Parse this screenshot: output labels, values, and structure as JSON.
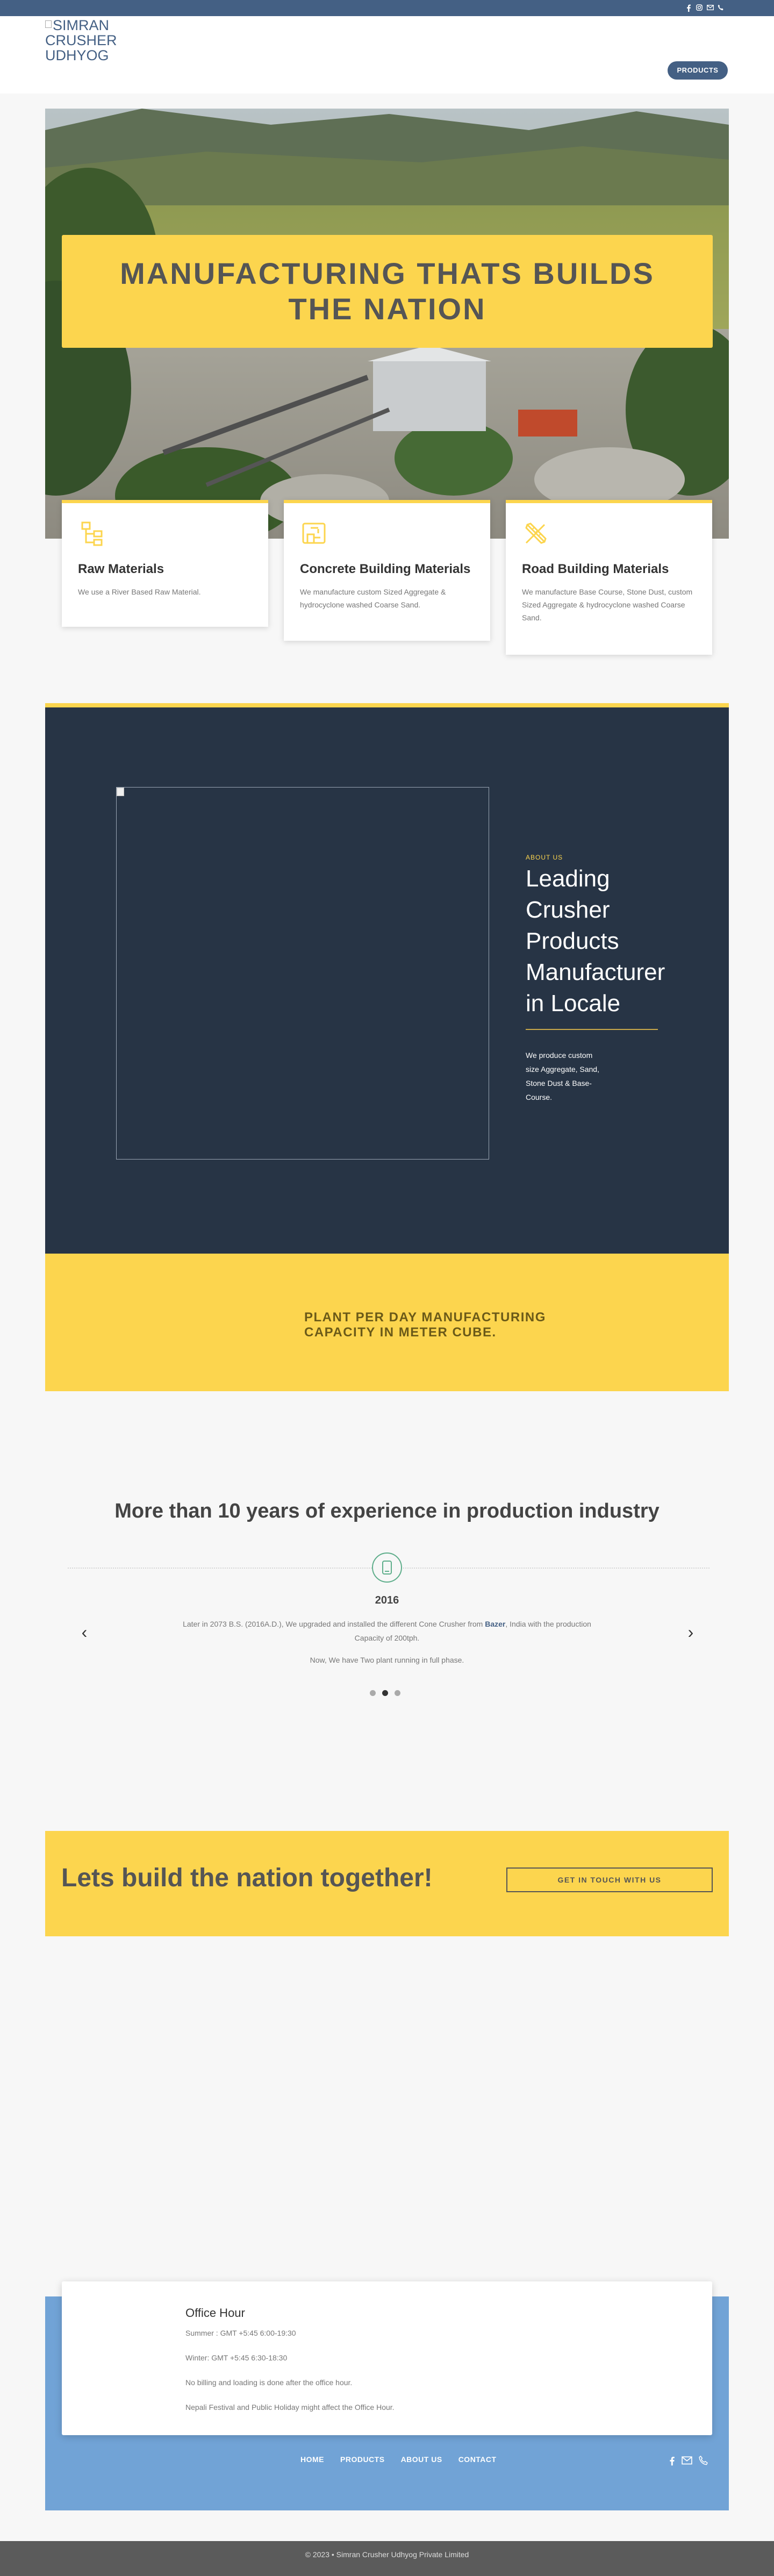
{
  "topbar": {
    "icons": [
      "facebook-icon",
      "instagram-icon",
      "email-icon",
      "phone-icon"
    ]
  },
  "header": {
    "logo_alt": "SIMRAN CRUSHER UDHYOG",
    "nav": {
      "products_label": "PRODUCTS"
    }
  },
  "hero": {
    "title": "MANUFACTURING THATS BUILDS THE NATION"
  },
  "features": [
    {
      "icon": "flowchart-icon",
      "title": "Raw Materials",
      "text": "We use a River Based Raw Material."
    },
    {
      "icon": "blueprint-icon",
      "title": "Concrete Building Materials",
      "text": "We manufacture custom Sized Aggregate & hydrocyclone washed Coarse Sand."
    },
    {
      "icon": "design-tools-icon",
      "title": "Road Building Materials",
      "text": "We manufacture Base Course, Stone Dust, custom Sized Aggregate & hydrocyclone washed Coarse Sand."
    }
  ],
  "about": {
    "kicker": "ABOUT US",
    "title": "Leading Crusher Products Manufacturer in Locale",
    "description": "We produce custom size Aggregate, Sand, Stone Dust & Base-Course."
  },
  "capacity": {
    "text": "PLANT PER DAY MANUFACTURING CAPACITY IN METER CUBE."
  },
  "experience": {
    "title": "More than 10 years of experience in production industry",
    "year": "2016",
    "text_before": "Later in 2073 B.S. (2016A.D.), We upgraded and installed the different Cone Crusher from ",
    "link": "Bazer",
    "text_after": ", India with the production Capacity of 200tph.",
    "text2": "Now, We have Two plant running in full phase.",
    "prev_arrow": "‹",
    "next_arrow": "›",
    "slides": 3,
    "active_slide": 2
  },
  "cta": {
    "title": "Lets build the nation together!",
    "button": "GET IN TOUCH WITH US"
  },
  "office": {
    "title": "Office Hour",
    "summer": "Summer : GMT +5:45 6:00-19:30",
    "winter": "Winter: GMT +5:45 6:30-18:30",
    "note1": "No billing and loading is done after the office hour.",
    "note2": "Nepali Festival and Public Holiday might affect the Office Hour."
  },
  "footer": {
    "nav": [
      "HOME",
      "PRODUCTS",
      "ABOUT US",
      "CONTACT"
    ],
    "icons": [
      "facebook-icon",
      "email-icon",
      "phone-icon"
    ],
    "copyright": "© 2023 • Simran Crusher Udhyog Private Limited"
  },
  "colors": {
    "primary": "#446084",
    "accent_yellow": "#fcd54e",
    "dark_navy": "#273445",
    "footer_blue": "#71a3d6"
  }
}
